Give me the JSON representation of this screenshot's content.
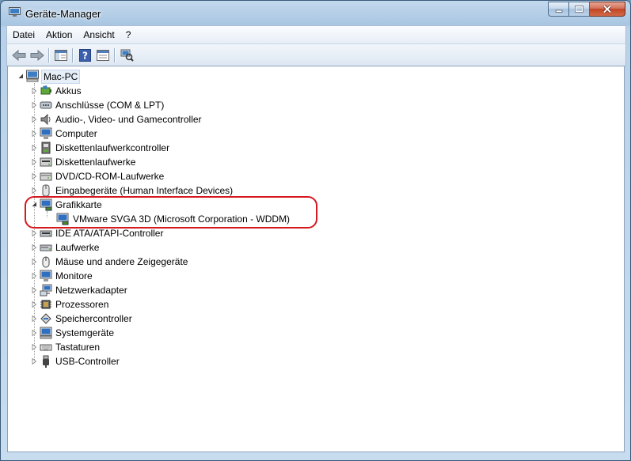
{
  "window": {
    "title": "Geräte-Manager"
  },
  "menu": [
    "Datei",
    "Aktion",
    "Ansicht",
    "?"
  ],
  "toolbar": [
    {
      "name": "back-icon",
      "label": ""
    },
    {
      "name": "forward-icon",
      "label": ""
    },
    {
      "name": "show-hide-tree-icon",
      "label": ""
    },
    {
      "name": "help-icon",
      "label": "?"
    },
    {
      "name": "properties-icon",
      "label": ""
    },
    {
      "name": "scan-hardware-icon",
      "label": ""
    }
  ],
  "tree": {
    "root": "Mac-PC",
    "items": [
      {
        "label": "Akkus",
        "icon": "battery-icon",
        "expanded": false
      },
      {
        "label": "Anschlüsse (COM & LPT)",
        "icon": "port-icon",
        "expanded": false
      },
      {
        "label": "Audio-, Video- und Gamecontroller",
        "icon": "speaker-icon",
        "expanded": false
      },
      {
        "label": "Computer",
        "icon": "computer-icon",
        "expanded": false
      },
      {
        "label": "Diskettenlaufwerkcontroller",
        "icon": "floppy-controller-icon",
        "expanded": false
      },
      {
        "label": "Diskettenlaufwerke",
        "icon": "floppy-drive-icon",
        "expanded": false
      },
      {
        "label": "DVD/CD-ROM-Laufwerke",
        "icon": "dvd-drive-icon",
        "expanded": false
      },
      {
        "label": "Eingabegeräte (Human Interface Devices)",
        "icon": "hid-icon",
        "expanded": false
      },
      {
        "label": "Grafikkarte",
        "icon": "display-adapter-icon",
        "expanded": true,
        "children": [
          "VMware SVGA 3D (Microsoft Corporation - WDDM)"
        ]
      },
      {
        "label": "IDE ATA/ATAPI-Controller",
        "icon": "ide-controller-icon",
        "expanded": false
      },
      {
        "label": "Laufwerke",
        "icon": "disk-drive-icon",
        "expanded": false
      },
      {
        "label": "Mäuse und andere Zeigegeräte",
        "icon": "mouse-icon",
        "expanded": false
      },
      {
        "label": "Monitore",
        "icon": "monitor-icon",
        "expanded": false
      },
      {
        "label": "Netzwerkadapter",
        "icon": "network-adapter-icon",
        "expanded": false
      },
      {
        "label": "Prozessoren",
        "icon": "processor-icon",
        "expanded": false
      },
      {
        "label": "Speichercontroller",
        "icon": "storage-controller-icon",
        "expanded": false
      },
      {
        "label": "Systemgeräte",
        "icon": "system-device-icon",
        "expanded": false
      },
      {
        "label": "Tastaturen",
        "icon": "keyboard-icon",
        "expanded": false
      },
      {
        "label": "USB-Controller",
        "icon": "usb-icon",
        "expanded": false
      }
    ]
  },
  "colors": {
    "highlight": "#d4191f",
    "selection": "#e6eef8"
  }
}
